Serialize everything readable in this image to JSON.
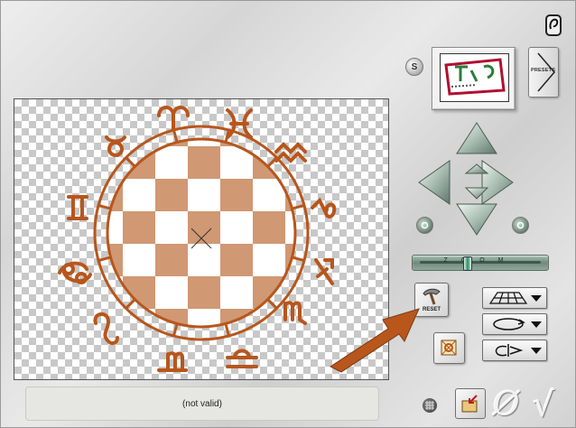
{
  "preview": {
    "status_text": "(not valid)"
  },
  "toolbar": {
    "s_label": "S",
    "presets_label": "PRESETS",
    "reset_label": "RESET",
    "zoom_label": "ZOOM",
    "cancel_glyph": "Ø",
    "ok_glyph": "√"
  },
  "colors": {
    "artwork": "#b8561c",
    "arrow": "#b8561c",
    "nav_green": "#a9bdb2"
  },
  "icons": {
    "help": "help-icon",
    "grid": "grid-icon",
    "import": "import-icon",
    "pattern": "pattern-icon"
  }
}
